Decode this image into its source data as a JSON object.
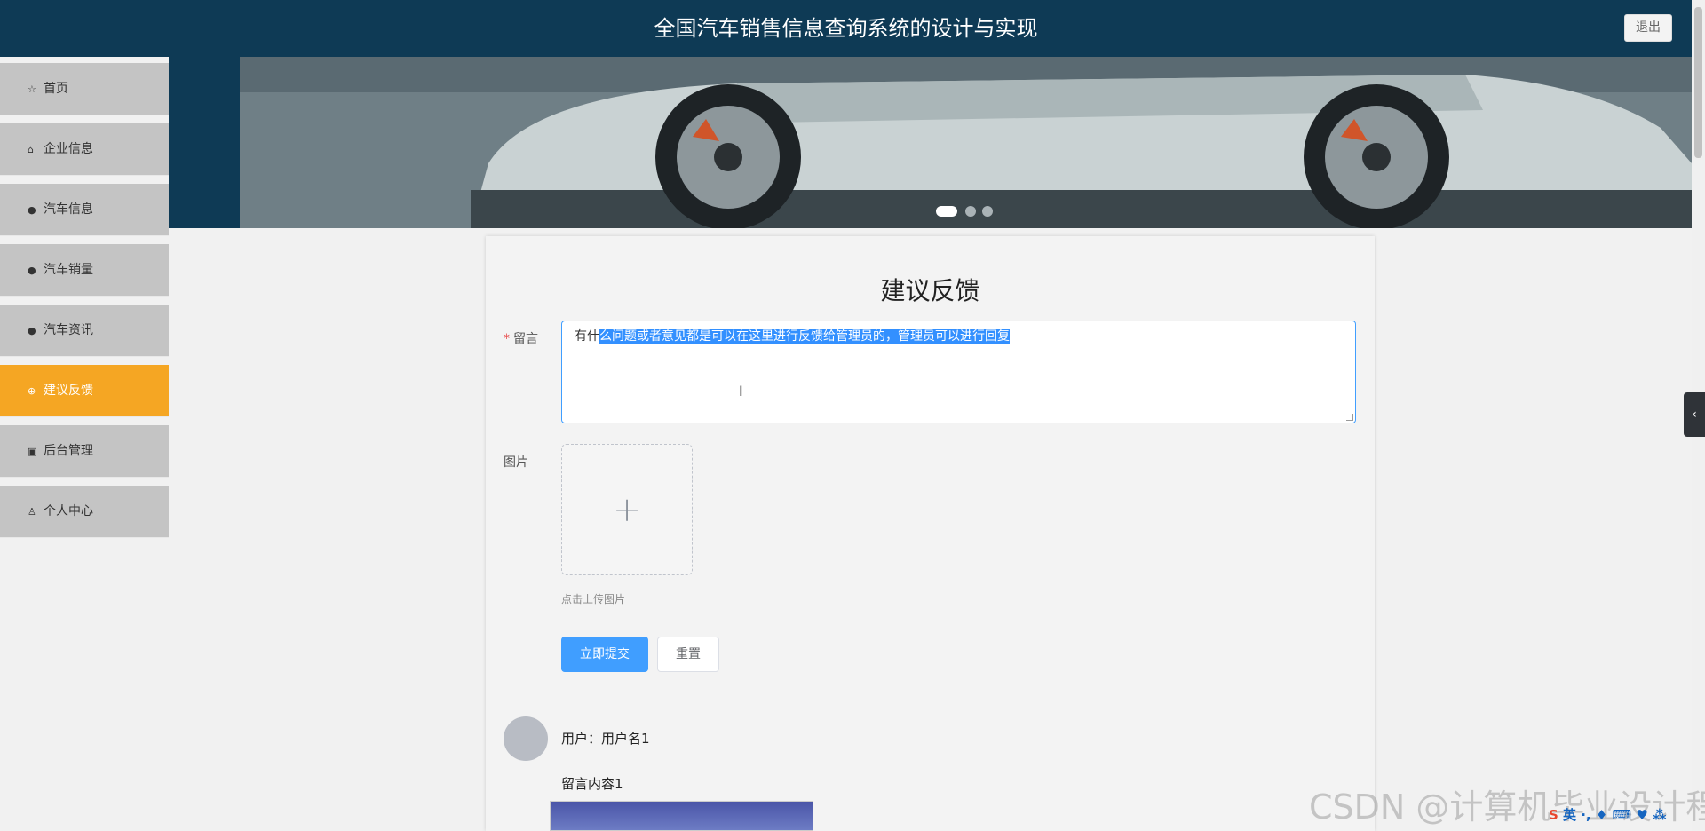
{
  "header": {
    "title": "全国汽车销售信息查询系统的设计与实现",
    "logout_label": "退出"
  },
  "sidebar": {
    "items": [
      {
        "label": "首页",
        "icon": "star-icon",
        "glyph": "☆",
        "active": false
      },
      {
        "label": "企业信息",
        "icon": "bag-icon",
        "glyph": "⌂",
        "active": false
      },
      {
        "label": "汽车信息",
        "icon": "alert-icon",
        "glyph": "●",
        "active": false
      },
      {
        "label": "汽车销量",
        "icon": "question-icon",
        "glyph": "●",
        "active": false
      },
      {
        "label": "汽车资讯",
        "icon": "info-icon",
        "glyph": "●",
        "active": false
      },
      {
        "label": "建议反馈",
        "icon": "globe-icon",
        "glyph": "⊕",
        "active": true
      },
      {
        "label": "后台管理",
        "icon": "briefcase-icon",
        "glyph": "▣",
        "active": false
      },
      {
        "label": "个人中心",
        "icon": "user-icon",
        "glyph": "♙",
        "active": false
      }
    ]
  },
  "banner": {
    "slides": 3,
    "active_slide": 1
  },
  "form": {
    "title": "建议反馈",
    "message_label": "留言",
    "message_prefix": "有什",
    "message_selected": "么问题或者意见都是可以在这里进行反馈给管理员的，管理员可以进行回复",
    "image_label": "图片",
    "upload_glyph": "+",
    "upload_hint": "点击上传图片",
    "submit_label": "立即提交",
    "reset_label": "重置"
  },
  "comments": [
    {
      "user": "用户：用户名1",
      "content": "留言内容1"
    }
  ],
  "watermark": "CSDN @计算机毕业设计程",
  "ime": {
    "logo": "S",
    "text": "英 ·, ♦ ⌨ ♥ ⁂"
  },
  "side_tab_glyph": "‹",
  "cursor_glyph": "I",
  "colors": {
    "header_bg": "#0e3a55",
    "active_menu": "#f5a623",
    "primary": "#409eff"
  }
}
